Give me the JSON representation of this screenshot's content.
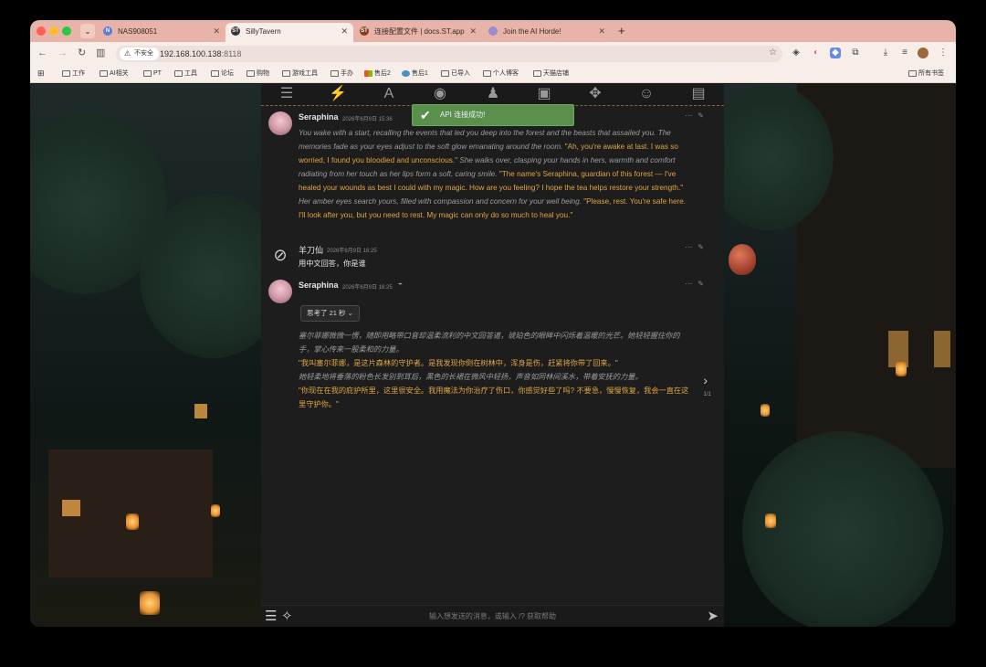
{
  "browser": {
    "tabs": [
      {
        "label": "NAS908051",
        "favicon": "nas-favicon",
        "favicon_color": "#5b7be0",
        "active": false
      },
      {
        "label": "SillyTavern",
        "favicon": "st-favicon",
        "favicon_color": "#333333",
        "active": true
      },
      {
        "label": "连接配置文件 | docs.ST.app",
        "favicon": "st-favicon",
        "favicon_color": "#8a3a20",
        "active": false
      },
      {
        "label": "Join the AI Horde!",
        "favicon": "horde-favicon",
        "favicon_color": "#9a8ad0",
        "active": false
      }
    ],
    "tab_menu_icon": "chevron-down",
    "new_tab_label": "+",
    "address": {
      "insecure_label": "不安全",
      "host": "192.168.100.138",
      "port": ":8118"
    },
    "bookmarks": [
      {
        "label": "工作",
        "icon": "folder-icon"
      },
      {
        "label": "AI相关",
        "icon": "folder-icon"
      },
      {
        "label": "PT",
        "icon": "folder-icon"
      },
      {
        "label": "工具",
        "icon": "folder-icon"
      },
      {
        "label": "论坛",
        "icon": "folder-icon"
      },
      {
        "label": "购物",
        "icon": "folder-icon"
      },
      {
        "label": "游戏工具",
        "icon": "folder-icon"
      },
      {
        "label": "手办",
        "icon": "folder-icon"
      },
      {
        "label": "售后2",
        "icon": "windows-icon"
      },
      {
        "label": "售后1",
        "icon": "globe-icon"
      },
      {
        "label": "已导入",
        "icon": "folder-icon"
      },
      {
        "label": "个人博客",
        "icon": "folder-icon"
      },
      {
        "label": "天猫店铺",
        "icon": "folder-icon"
      }
    ],
    "all_bookmarks_label": "所有书签"
  },
  "toast": {
    "text": "API 连接成功!",
    "color": "#5a8f4c"
  },
  "messages": [
    {
      "author": "Seraphina",
      "time": "2026年6月9日 15:36",
      "segments": [
        {
          "type": "narration",
          "text": "You wake with a start, recalling the events that led you deep into the forest and the beasts that assailed you. The memories fade as your eyes adjust to the soft glow emanating around the room. "
        },
        {
          "type": "quote",
          "text": "\"Ah, you're awake at last. I was so worried, I found you bloodied and unconscious.\""
        },
        {
          "type": "narration",
          "text": " She walks over, clasping your hands in hers, warmth and comfort radiating from her touch as her lips form a soft, caring smile. "
        },
        {
          "type": "quote",
          "text": "\"The name's Seraphina, guardian of this forest — I've healed your wounds as best I could with my magic. How are you feeling? I hope the tea helps restore your strength.\""
        },
        {
          "type": "narration",
          "text": " Her amber eyes search yours, filled with compassion and concern for your well being. "
        },
        {
          "type": "quote",
          "text": "\"Please, rest. You're safe here. I'll look after you, but you need to rest. My magic can only do so much to heal you.\""
        }
      ]
    },
    {
      "author": "羊刀仙",
      "time": "2026年6月9日 16:25",
      "text": "用中文回答，你是谁"
    },
    {
      "author": "Seraphina",
      "time": "2026年6月9日 16:25",
      "think_label": "思考了 21 秒",
      "swipe_count": "1/1",
      "lines": [
        {
          "type": "narration",
          "text": "塞尔菲娜微微一愣，随即用略带口音却温柔流利的中文回答道，琥珀色的眼眸中闪烁着温暖的光芒。她轻轻握住你的手，掌心传来一股柔和的力量。"
        },
        {
          "type": "quote",
          "text": "\"我叫塞尔菲娜，是这片森林的守护者。是我发现你倒在树林中，浑身是伤，赶紧将你带了回来。\""
        },
        {
          "type": "narration",
          "text": "她轻柔地将垂落的粉色长发别到耳后，黑色的长裙在微风中轻扬，声音如同林间溪水，带着安抚的力量。"
        },
        {
          "type": "quote",
          "text": "\"你现在在我的庇护所里，这里很安全。我用魔法为你治疗了伤口，你感觉好些了吗? 不要急，慢慢恢复，我会一直在这里守护你。\""
        }
      ]
    }
  ],
  "input": {
    "placeholder": "输入想发送的消息，或输入 /? 获取帮助"
  },
  "colors": {
    "quote": "#e0a442",
    "narration": "#9d9d9d",
    "accent": "#5a8f4c"
  }
}
